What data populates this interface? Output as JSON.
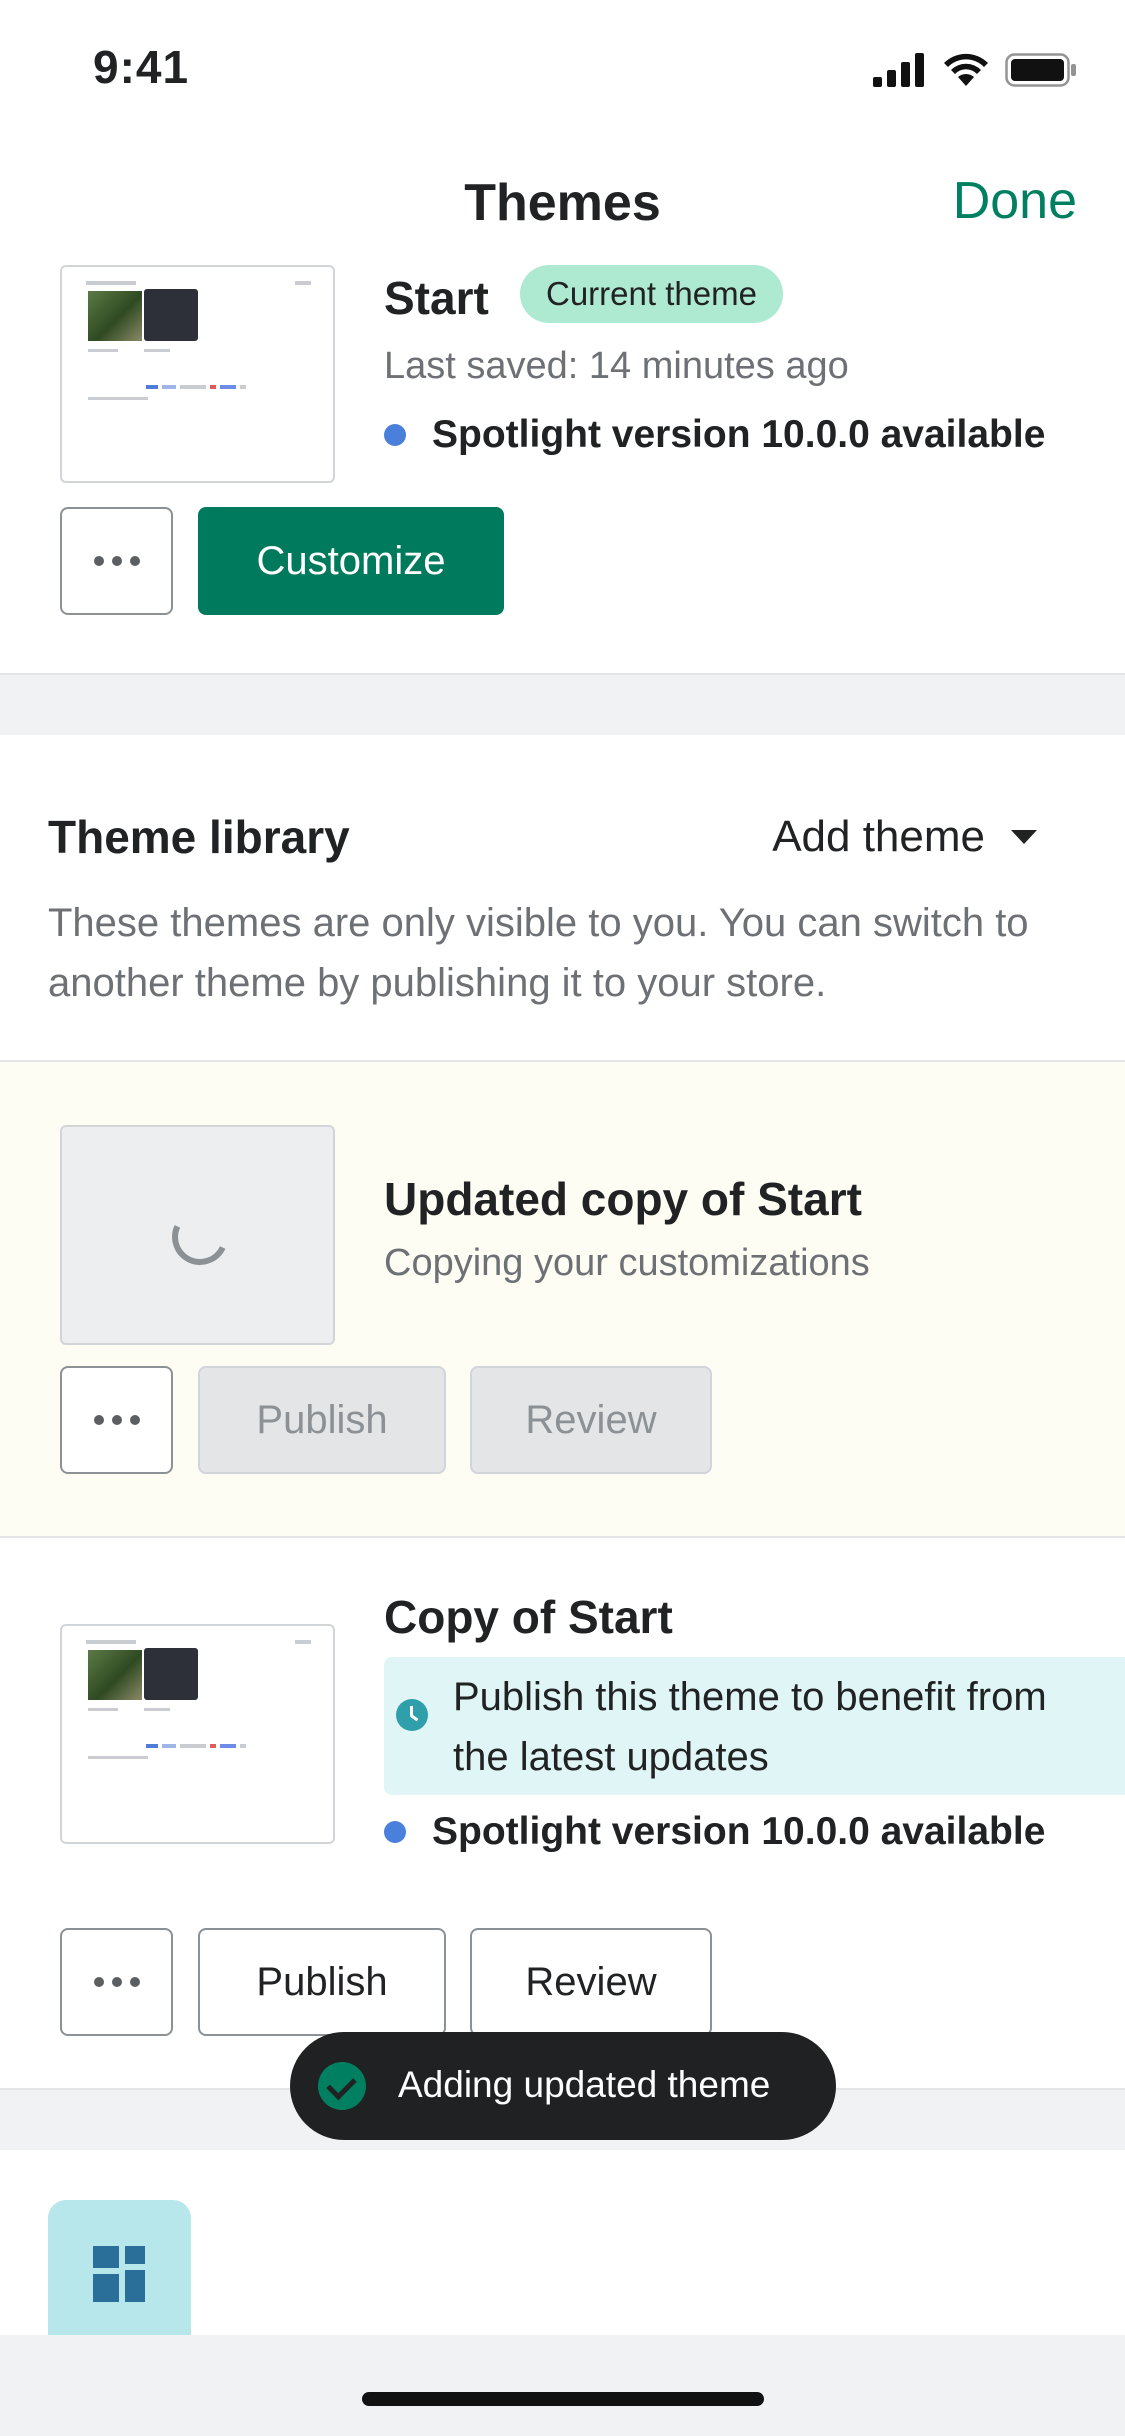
{
  "status_bar": {
    "time": "9:41"
  },
  "nav": {
    "title": "Themes",
    "done_label": "Done"
  },
  "current_theme": {
    "name": "Start",
    "badge": "Current theme",
    "last_saved": "Last saved: 14 minutes ago",
    "version_notice": "Spotlight version 10.0.0 available",
    "customize_label": "Customize"
  },
  "library": {
    "title": "Theme library",
    "add_theme_label": "Add theme",
    "description": "These themes are only visible to you. You can switch to another theme by publishing it to your store.",
    "themes": [
      {
        "name": "Updated copy of Start",
        "status": "Copying your customizations",
        "publish_label": "Publish",
        "review_label": "Review"
      },
      {
        "name": "Copy of Start",
        "notice": "Publish this theme to benefit from the latest updates",
        "version_notice": "Spotlight version 10.0.0 available",
        "publish_label": "Publish",
        "review_label": "Review"
      }
    ]
  },
  "toast": {
    "message": "Adding updated theme"
  },
  "colors": {
    "accent": "#008060",
    "primary_button": "#007a5c",
    "badge": "#aee9d1",
    "notice_bg": "#e0f5f5",
    "updating_bg": "#fefdf4"
  },
  "icons": [
    "signal-icon",
    "wifi-icon",
    "battery-icon",
    "more-icon",
    "chevron-down-icon",
    "spinner-icon",
    "clock-icon",
    "check-circle-icon",
    "layout-icon"
  ]
}
